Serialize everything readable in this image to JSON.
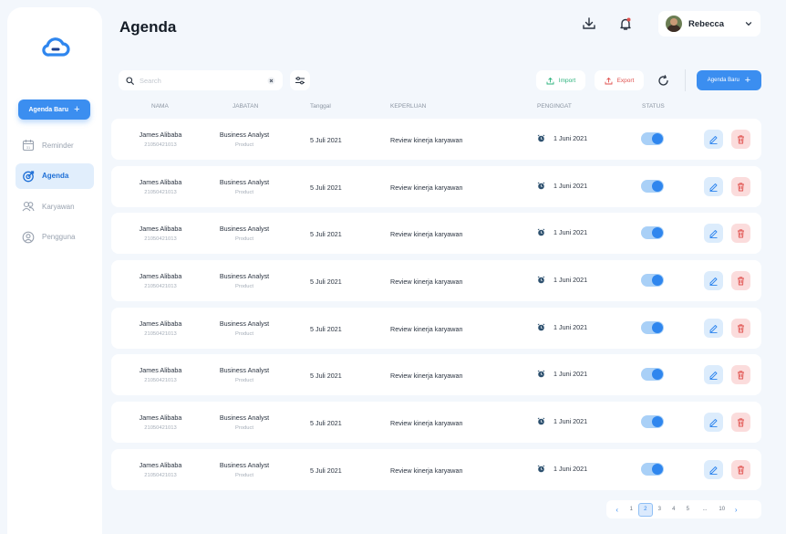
{
  "app": {
    "title": "Agenda"
  },
  "sidebar": {
    "new_button": "Agenda Baru",
    "items": [
      {
        "label": "Reminder",
        "icon": "calendar-icon",
        "active": false
      },
      {
        "label": "Agenda",
        "icon": "target-icon",
        "active": true
      },
      {
        "label": "Karyawan",
        "icon": "users-icon",
        "active": false
      },
      {
        "label": "Pengguna",
        "icon": "user-circle-icon",
        "active": false
      }
    ]
  },
  "header": {
    "user_name": "Rebecca"
  },
  "toolbar": {
    "search_placeholder": "Search",
    "import_label": "Import",
    "export_label": "Export",
    "new_button": "Agenda Baru"
  },
  "table": {
    "columns": [
      "NAMA",
      "JABATAN",
      "Tanggal",
      "KEPERLUAN",
      "PENGINGAT",
      "STATUS"
    ],
    "rows": [
      {
        "name": "James Alibaba",
        "id": "21050421013",
        "position": "Business Analyst",
        "department": "Product",
        "date": "5 Juli 2021",
        "purpose": "Review kinerja karyawan",
        "reminder": "1 Juni 2021",
        "status": true
      },
      {
        "name": "James Alibaba",
        "id": "21050421013",
        "position": "Business Analyst",
        "department": "Product",
        "date": "5 Juli 2021",
        "purpose": "Review kinerja karyawan",
        "reminder": "1 Juni 2021",
        "status": true
      },
      {
        "name": "James Alibaba",
        "id": "21050421013",
        "position": "Business Analyst",
        "department": "Product",
        "date": "5 Juli 2021",
        "purpose": "Review kinerja karyawan",
        "reminder": "1 Juni 2021",
        "status": true
      },
      {
        "name": "James Alibaba",
        "id": "21050421013",
        "position": "Business Analyst",
        "department": "Product",
        "date": "5 Juli 2021",
        "purpose": "Review kinerja karyawan",
        "reminder": "1 Juni 2021",
        "status": true
      },
      {
        "name": "James Alibaba",
        "id": "21050421013",
        "position": "Business Analyst",
        "department": "Product",
        "date": "5 Juli 2021",
        "purpose": "Review kinerja karyawan",
        "reminder": "1 Juni 2021",
        "status": true
      },
      {
        "name": "James Alibaba",
        "id": "21050421013",
        "position": "Business Analyst",
        "department": "Product",
        "date": "5 Juli 2021",
        "purpose": "Review kinerja karyawan",
        "reminder": "1 Juni 2021",
        "status": true
      },
      {
        "name": "James Alibaba",
        "id": "21050421013",
        "position": "Business Analyst",
        "department": "Product",
        "date": "5 Juli 2021",
        "purpose": "Review kinerja karyawan",
        "reminder": "1 Juni 2021",
        "status": true
      },
      {
        "name": "James Alibaba",
        "id": "21050421013",
        "position": "Business Analyst",
        "department": "Product",
        "date": "5 Juli 2021",
        "purpose": "Review kinerja karyawan",
        "reminder": "1 Juni 2021",
        "status": true
      }
    ]
  },
  "pagination": {
    "pages": [
      "1",
      "2",
      "3",
      "4",
      "5",
      "...",
      "10"
    ],
    "current": "2",
    "prev": "‹",
    "next": "›"
  },
  "colors": {
    "accent": "#3b8ef0",
    "import": "#2db37d",
    "export": "#e0524f",
    "background": "#f3f7fc"
  }
}
